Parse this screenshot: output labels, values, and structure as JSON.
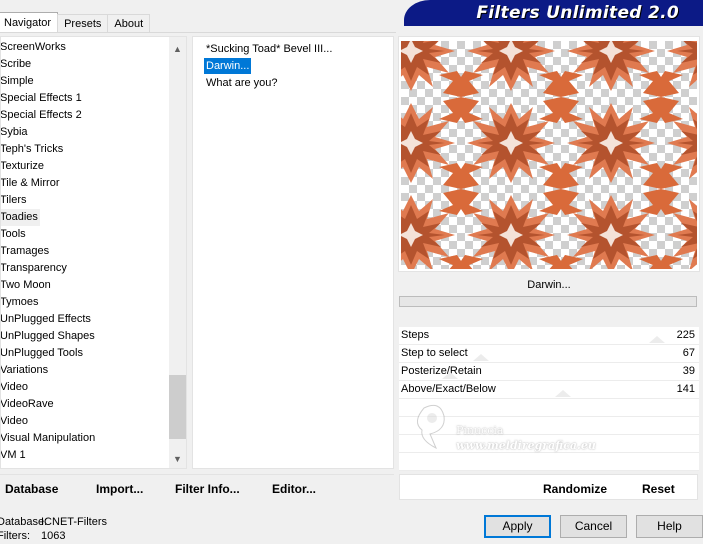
{
  "header": {
    "title": "Filters Unlimited 2.0"
  },
  "tabs": [
    {
      "label": "Navigator",
      "active": true
    },
    {
      "label": "Presets",
      "active": false
    },
    {
      "label": "About",
      "active": false
    }
  ],
  "categories": [
    "ScreenWorks",
    "Scribe",
    "Simple",
    "Special Effects 1",
    "Special Effects 2",
    "Sybia",
    "Teph's Tricks",
    "Texturize",
    "Tile & Mirror",
    "Tilers",
    "Toadies",
    "Tools",
    "Tramages",
    "Transparency",
    "Two Moon",
    "Tymoes",
    "UnPlugged Effects",
    "UnPlugged Shapes",
    "UnPlugged Tools",
    "Variations",
    "Video",
    "VideoRave",
    "Video",
    "Visual Manipulation",
    "VM 1"
  ],
  "selected_category": "Toadies",
  "filters": [
    "*Sucking Toad*  Bevel III...",
    "Darwin...",
    "What are you?"
  ],
  "selected_filter": "Darwin...",
  "preview": {
    "filter_name": "Darwin..."
  },
  "params": [
    {
      "label": "Steps",
      "value": "225",
      "level": 0.88
    },
    {
      "label": "Step to select",
      "value": "67",
      "level": 0.26
    },
    {
      "label": "Posterize/Retain",
      "value": "39",
      "level": 0.15
    },
    {
      "label": "Above/Exact/Below",
      "value": "141",
      "level": 0.55
    }
  ],
  "toolbar": {
    "database": "Database",
    "import": "Import...",
    "filter_info": "Filter Info...",
    "editor": "Editor...",
    "randomize": "Randomize",
    "reset": "Reset"
  },
  "footer": {
    "database_label": "Database:",
    "database_value": "ICNET-Filters",
    "filters_label": "Filters:",
    "filters_value": "1063"
  },
  "buttons": {
    "apply": "Apply",
    "cancel": "Cancel",
    "help": "Help"
  },
  "watermark": {
    "name": "Pinuccia",
    "url": "www.meldiregrafica.eu"
  },
  "colors": {
    "banner": "#0c1a86",
    "selection": "#0078d7",
    "pattern_dark": "#b4532e",
    "pattern_light": "#e07a50"
  }
}
